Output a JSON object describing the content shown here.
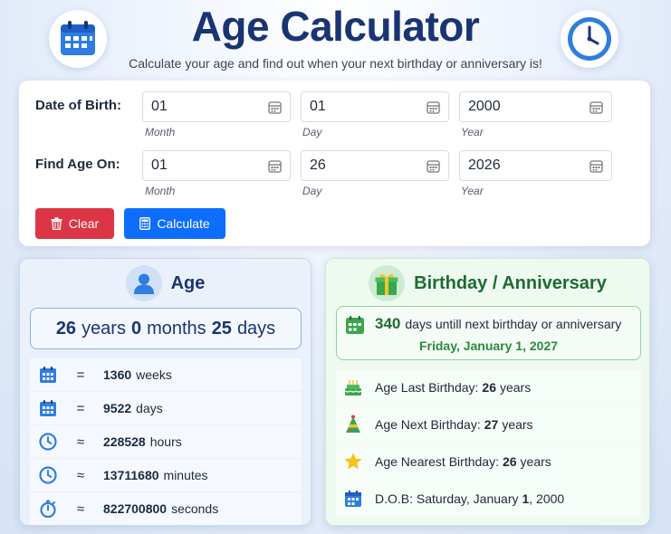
{
  "header": {
    "title": "Age Calculator",
    "subtitle": "Calculate your age and find out when your next birthday or anniversary is!"
  },
  "form": {
    "dob_label": "Date of Birth:",
    "dob": {
      "month": "01",
      "day": "01",
      "year": "2000"
    },
    "find_label": "Find Age On:",
    "find": {
      "month": "01",
      "day": "26",
      "year": "2026"
    },
    "hints": {
      "month": "Month",
      "day": "Day",
      "year": "Year"
    },
    "clear_label": "Clear",
    "calculate_label": "Calculate"
  },
  "age": {
    "heading": "Age",
    "years": "26",
    "years_unit": "years",
    "months": "0",
    "months_unit": "months",
    "days": "25",
    "days_unit": "days",
    "rows": [
      {
        "icon": "calendar-icon",
        "op": "=",
        "value": "1360",
        "unit": "weeks"
      },
      {
        "icon": "calendar-icon",
        "op": "=",
        "value": "9522",
        "unit": "days"
      },
      {
        "icon": "clock-icon",
        "op": "≈",
        "value": "228528",
        "unit": "hours"
      },
      {
        "icon": "clock-icon",
        "op": "≈",
        "value": "13711680",
        "unit": "minutes"
      },
      {
        "icon": "stopwatch-icon",
        "op": "≈",
        "value": "822700800",
        "unit": "seconds"
      }
    ]
  },
  "birthday": {
    "heading": "Birthday / Anniversary",
    "next_days": "340",
    "next_text": "days untill next birthday or anniversary",
    "next_date": "Friday, January 1, 2027",
    "last_label": "Age Last Birthday:",
    "last_value": "26",
    "last_unit": "years",
    "next_label": "Age Next Birthday:",
    "next_value": "27",
    "next_unit": "years",
    "nearest_label": "Age Nearest Birthday:",
    "nearest_value": "26",
    "nearest_unit": "years",
    "dob_prefix": "D.O.B: Saturday, January",
    "dob_day": "1",
    "dob_suffix": ", 2000"
  },
  "colors": {
    "accent_blue": "#0d6efd",
    "danger_red": "#dc3545",
    "title_navy": "#1a3473",
    "success_green": "#1f6b31"
  }
}
